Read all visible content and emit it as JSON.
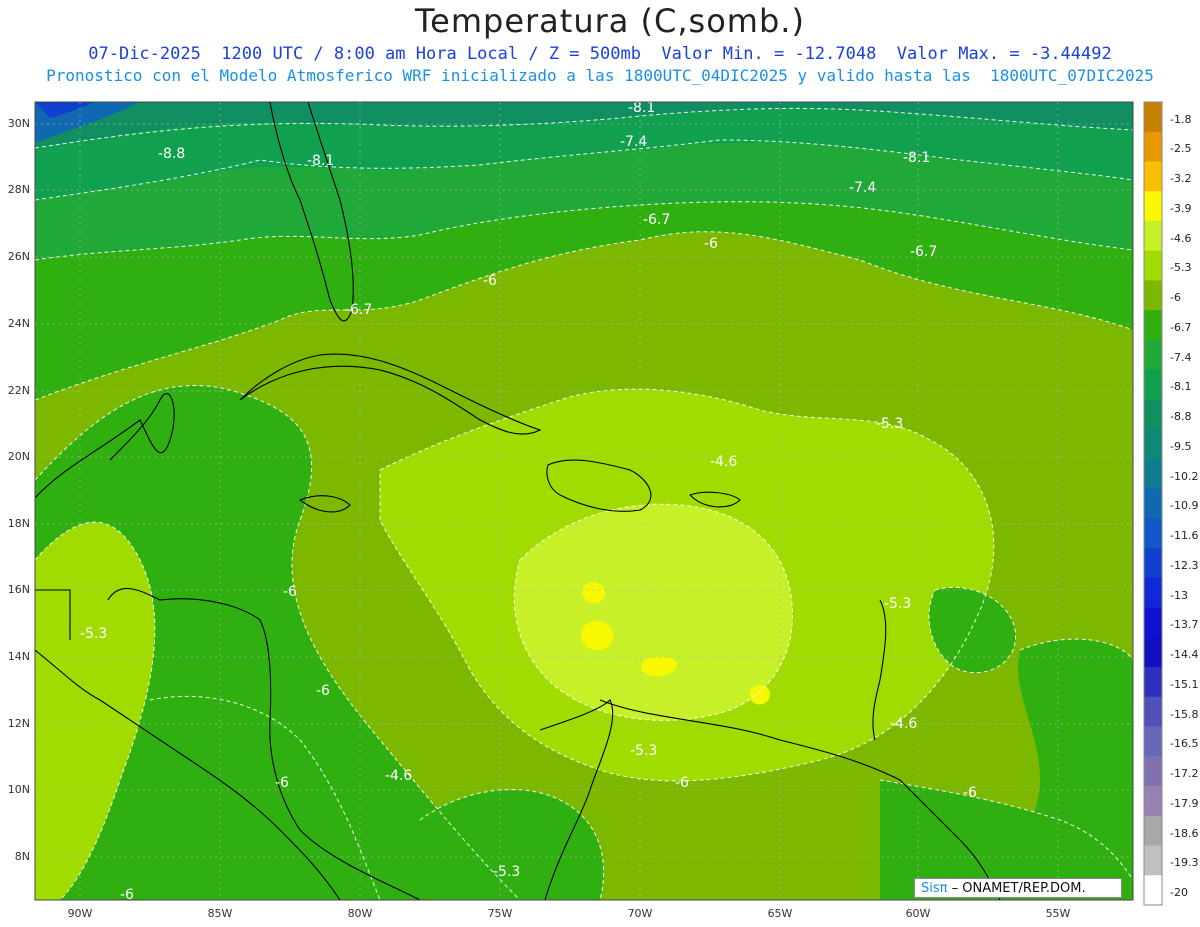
{
  "header": {
    "title": "Temperatura (C,somb.)",
    "line1": "07-Dic-2025  1200 UTC / 8:00 am Hora Local / Z = 500mb  Valor Min. = -12.7048  Valor Max. = -3.44492",
    "line2": "Pronostico con el Modelo Atmosferico WRF inicializado a las 1800UTC_04DIC2025 y valido hasta las  1800UTC_07DIC2025"
  },
  "axes": {
    "lat_labels": [
      "30N",
      "28N",
      "26N",
      "24N",
      "22N",
      "20N",
      "18N",
      "16N",
      "14N",
      "12N",
      "10N",
      "8N"
    ],
    "lon_labels": [
      "90W",
      "85W",
      "80W",
      "75W",
      "70W",
      "65W",
      "60W",
      "55W"
    ]
  },
  "colorbar": {
    "labels": [
      "-1.8",
      "-2.5",
      "-3.2",
      "-3.9",
      "-4.6",
      "-5.3",
      "-6",
      "-6.7",
      "-7.4",
      "-8.1",
      "-8.8",
      "-9.5",
      "-10.2",
      "-10.9",
      "-11.6",
      "-12.3",
      "-13",
      "-13.7",
      "-14.4",
      "-15.1",
      "-15.8",
      "-16.5",
      "-17.2",
      "-17.9",
      "-18.6",
      "-19.3",
      "-20"
    ],
    "colors": [
      "#c88000",
      "#e89800",
      "#f8c000",
      "#f8f800",
      "#c8f028",
      "#a0dc00",
      "#7cb800",
      "#30b010",
      "#20a838",
      "#10a050",
      "#109060",
      "#108878",
      "#107c90",
      "#1068b0",
      "#1058c8",
      "#1040d0",
      "#1028d8",
      "#1010d0",
      "#1010c0",
      "#3030c0",
      "#5050b8",
      "#6868b8",
      "#8070b0",
      "#9880b0",
      "#a8a8a8",
      "#c0c0c0",
      "#ffffff"
    ]
  },
  "contour_labels": [
    "-8.1",
    "-7.4",
    "-8.8",
    "-8.1",
    "-8.1",
    "-7.4",
    "-6.7",
    "-6",
    "-6.7",
    "-6",
    "-6.7",
    "-5.3",
    "-4.6",
    "-5.3",
    "-6",
    "-5.3",
    "-6",
    "-6",
    "-4.6",
    "-4.6",
    "-5.3",
    "-6",
    "-6",
    "-5.3",
    "-6",
    "-5.3"
  ],
  "credits": {
    "sis": "Sisπ",
    "org": "– ONAMET/REP.DOM."
  }
}
